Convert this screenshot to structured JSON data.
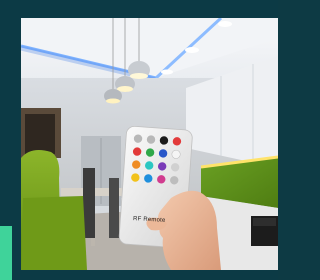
{
  "remote": {
    "label": "RF Remote"
  },
  "colors": {
    "frame": "#0c3a45",
    "accent": "#3fd39a",
    "led_strip": "#6fa9ff",
    "sofa": "#7da61e",
    "moss_wall": "#5e8f1a"
  },
  "scene": {
    "icons": [
      "pendant-lamp-icon",
      "recessed-light-icon",
      "remote-control-icon",
      "hand-icon"
    ]
  }
}
